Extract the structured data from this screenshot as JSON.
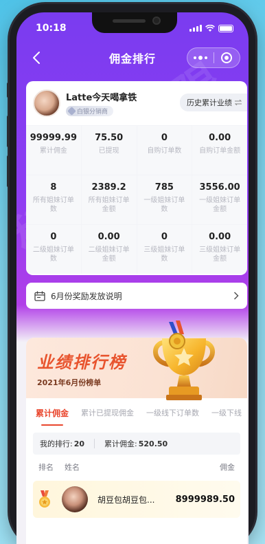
{
  "status_bar": {
    "time": "10:18"
  },
  "navbar": {
    "title": "佣金排行"
  },
  "user": {
    "name": "Latte今天喝拿铁",
    "level": "白银分销商",
    "history_button": "历史累计业绩"
  },
  "stats": [
    {
      "value": "99999.99",
      "label": "累计佣金"
    },
    {
      "value": "75.50",
      "label": "已提现"
    },
    {
      "value": "0",
      "label": "自购订单数"
    },
    {
      "value": "0.00",
      "label": "自购订单金额"
    },
    {
      "value": "8",
      "label": "所有姐妹订单数"
    },
    {
      "value": "2389.2",
      "label": "所有姐妹订单金额"
    },
    {
      "value": "785",
      "label": "一级姐妹订单数"
    },
    {
      "value": "3556.00",
      "label": "一级姐妹订单金额"
    },
    {
      "value": "0",
      "label": "二级姐妹订单数"
    },
    {
      "value": "0.00",
      "label": "二级姐妹订单金额"
    },
    {
      "value": "0",
      "label": "三级姐妹订单数"
    },
    {
      "value": "0.00",
      "label": "三级姐妹订单金额"
    }
  ],
  "notice": {
    "text": "6月份奖励发放说明"
  },
  "ranking": {
    "banner_title": "业绩排行榜",
    "banner_subtitle": "2021年6月份榜单",
    "tabs": [
      "累计佣金",
      "累计已提现佣金",
      "一级线下订单数",
      "一级下线"
    ],
    "my_rank_label": "我的排行: ",
    "my_rank_value": "20",
    "my_commission_label": "累计佣金: ",
    "my_commission_value": "520.50",
    "col_rank": "排名",
    "col_name": "姓名",
    "col_commission": "佣金",
    "rows": [
      {
        "name": "胡豆包胡豆包...",
        "amount": "8999989.50"
      }
    ]
  }
}
